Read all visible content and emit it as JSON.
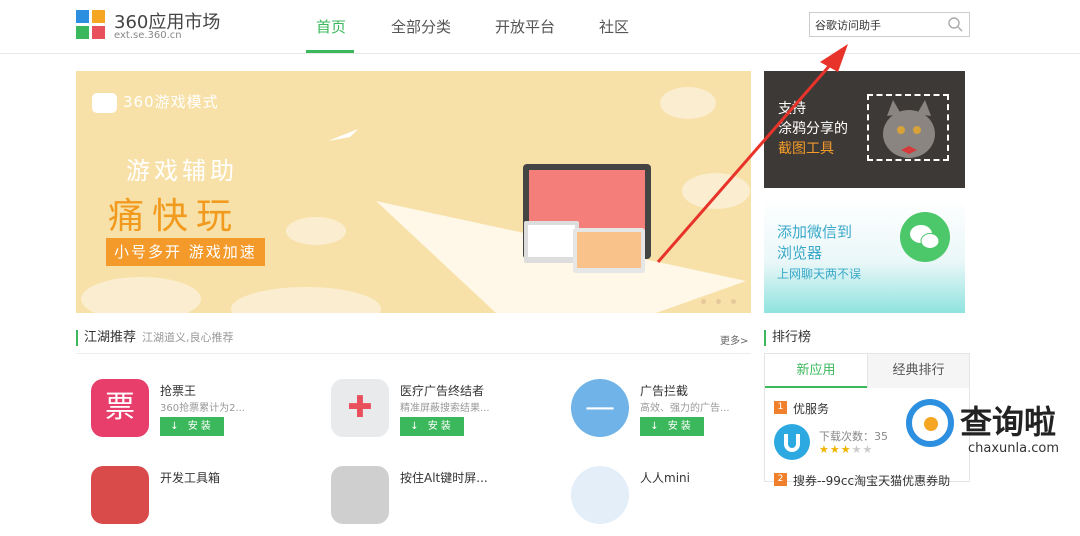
{
  "logo": {
    "title": "360应用市场",
    "subtitle": "ext.se.360.cn"
  },
  "nav": [
    "首页",
    "全部分类",
    "开放平台",
    "社区"
  ],
  "search": {
    "value": "谷歌访问助手"
  },
  "banner": {
    "mode": "360游戏模式",
    "title": "游戏辅助",
    "big_text": "痛快玩",
    "tag": "小号多开  游戏加速"
  },
  "promo_screenshot": {
    "line1": "支持",
    "line2": "涂鸦分享的",
    "line3": "截图工具"
  },
  "promo_wechat": {
    "line1": "添加微信到",
    "line2": "浏览器",
    "line3": "上网聊天两不误"
  },
  "recommend": {
    "title": "江湖推荐",
    "subtitle": "江湖道义,良心推荐",
    "more": "更多>"
  },
  "apps": [
    {
      "name": "抢票王",
      "desc": "360抢票累计为2...",
      "button": "↓ 安装",
      "icon_glyph": "票",
      "icon_color": "#e83e6c"
    },
    {
      "name": "医疗广告终结者",
      "desc": "精准屏蔽搜索结果...",
      "button": "↓ 安装",
      "icon_glyph": "✚",
      "icon_color": "#e8eaec"
    },
    {
      "name": "广告拦截",
      "desc": "高效、强力的广告...",
      "button": "↓ 安装",
      "icon_glyph": "—",
      "icon_color": "#6fb3e8"
    },
    {
      "name": "开发工具箱",
      "icon_color": "#d94b4b"
    },
    {
      "name": "按住Alt键时屏...",
      "icon_color": "#cfcfcf"
    },
    {
      "name": "人人mini",
      "icon_color": "#e3eef8"
    }
  ],
  "ranking": {
    "title": "排行榜",
    "tabs": [
      "新应用",
      "经典排行"
    ],
    "item1": {
      "num": "1",
      "name": "优服务",
      "downloads": "下载次数：35",
      "stars_full": "★★★",
      "stars_empty": "★★"
    },
    "item2": {
      "num": "2",
      "name": "搜券--99cc淘宝天猫优惠券助"
    }
  },
  "watermark": {
    "big": "查询啦",
    "small": "chaxunla.com"
  }
}
